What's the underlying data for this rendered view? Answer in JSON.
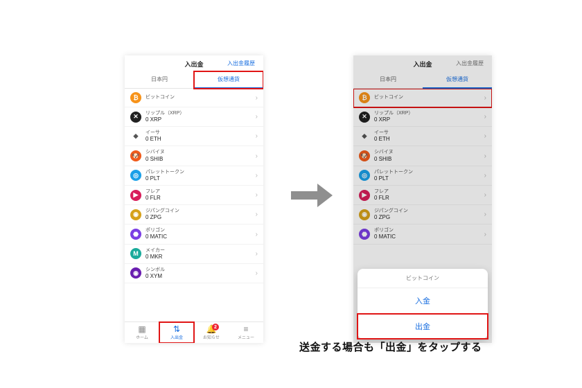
{
  "header": {
    "title": "入出金",
    "history_link": "入出金履歴"
  },
  "subtabs": {
    "jpy": "日本円",
    "crypto": "仮想通貨"
  },
  "coins": [
    {
      "name": "ビットコイン",
      "balance": "",
      "color": "#f7931a",
      "glyph": "₿",
      "key": "btc"
    },
    {
      "name": "リップル（XRP）",
      "balance": "0 XRP",
      "color": "#222",
      "glyph": "✕",
      "key": "xrp"
    },
    {
      "name": "イーサ",
      "balance": "0 ETH",
      "color": "#fff",
      "glyph": "◆",
      "fg": "#555",
      "key": "eth"
    },
    {
      "name": "シバイヌ",
      "balance": "0 SHIB",
      "color": "#f05a1a",
      "glyph": "🐶",
      "key": "shib"
    },
    {
      "name": "パレットトークン",
      "balance": "0 PLT",
      "color": "#1aa0e8",
      "glyph": "◎",
      "key": "plt"
    },
    {
      "name": "フレア",
      "balance": "0 FLR",
      "color": "#d81e5b",
      "glyph": "▶",
      "key": "flr"
    },
    {
      "name": "ジパングコイン",
      "balance": "0 ZPG",
      "color": "#d6a21a",
      "glyph": "◉",
      "key": "zpg"
    },
    {
      "name": "ポリゴン",
      "balance": "0 MATIC",
      "color": "#7b3fe4",
      "glyph": "⬣",
      "key": "matic"
    },
    {
      "name": "メイカー",
      "balance": "0 MKR",
      "color": "#1aab9b",
      "glyph": "M",
      "key": "mkr"
    },
    {
      "name": "シンボル",
      "balance": "0 XYM",
      "color": "#6a1eb0",
      "glyph": "◉",
      "key": "xym"
    }
  ],
  "tabbar": {
    "items": [
      {
        "label": "ホーム",
        "icon": "▦",
        "key": "home"
      },
      {
        "label": "入出金",
        "icon": "⇅",
        "key": "funds",
        "active": true
      },
      {
        "label": "お知らせ",
        "icon": "🔔",
        "key": "notice",
        "badge": "2"
      },
      {
        "label": "メニュー",
        "icon": "≡",
        "key": "menu"
      }
    ]
  },
  "sheet": {
    "title": "ビットコイン",
    "deposit": "入金",
    "withdraw": "出金"
  },
  "caption": "送金する場合も「出金」をタップする"
}
